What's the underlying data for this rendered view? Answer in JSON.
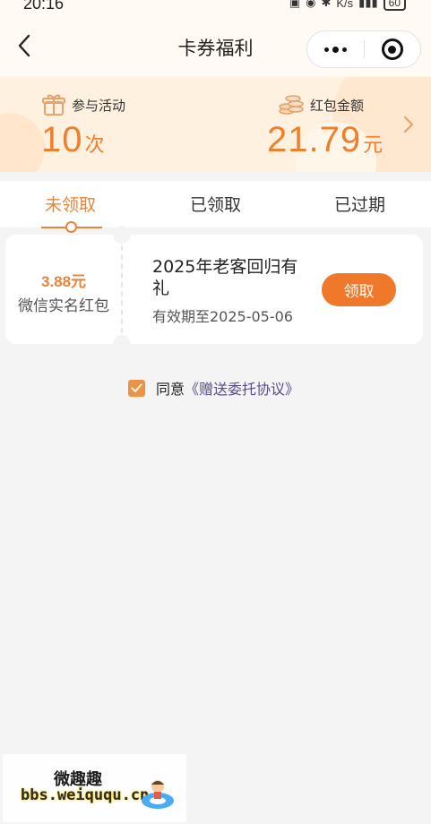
{
  "status_bar": {
    "time": "20:16",
    "network_speed": "K/s",
    "battery": "60"
  },
  "nav": {
    "title": "卡券福利"
  },
  "stats": {
    "participation": {
      "label": "参与活动",
      "value": "10",
      "unit": "次"
    },
    "red_packet": {
      "label": "红包金额",
      "value": "21.79",
      "unit": "元"
    }
  },
  "tabs": [
    {
      "label": "未领取",
      "active": true
    },
    {
      "label": "已领取",
      "active": false
    },
    {
      "label": "已过期",
      "active": false
    }
  ],
  "coupon": {
    "amount": "3.88元",
    "type": "微信实名红包",
    "title": "2025年老客回归有礼",
    "validity": "有效期至2025-05-06",
    "button": "领取"
  },
  "agreement": {
    "checked": true,
    "prefix": "同意",
    "link": "《赠送委托协议》"
  },
  "watermark": {
    "title": "微趣趣",
    "url": "bbs.weiququ.cn"
  },
  "colors": {
    "accent": "#f0782a",
    "accent_text": "#e8843a",
    "link": "#5b4a8a",
    "banner_bg": "#fff1e0"
  }
}
